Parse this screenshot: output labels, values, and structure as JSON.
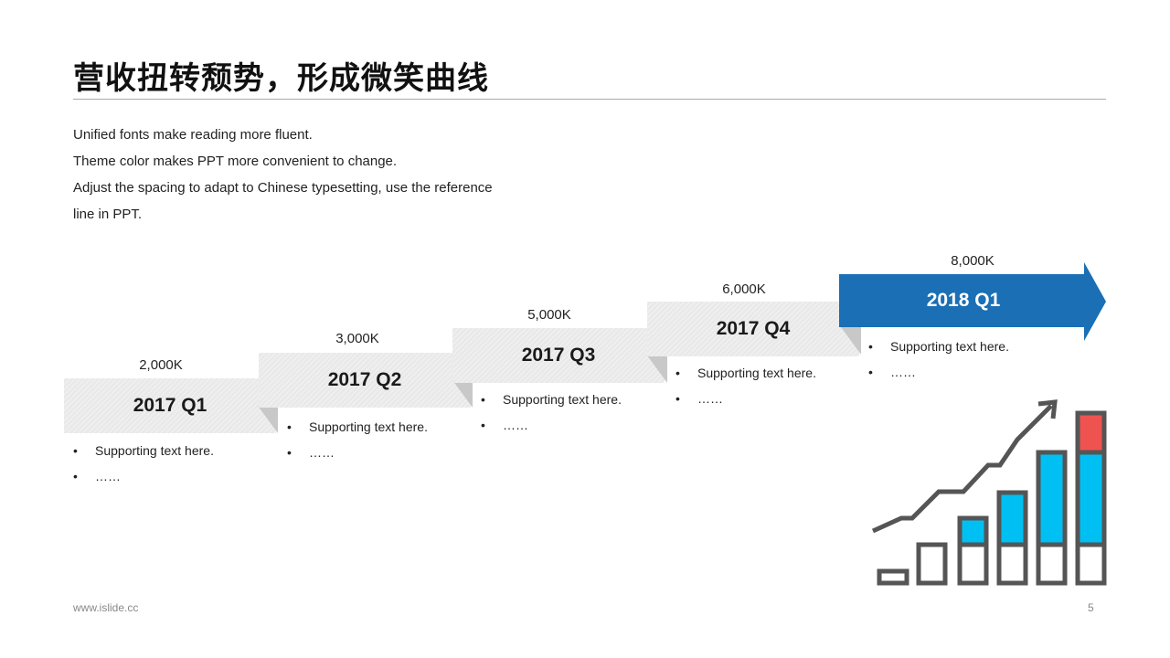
{
  "page": {
    "title": "营收扭转颓势，形成微笑曲线",
    "intro": [
      "Unified fonts make reading more fluent.",
      "Theme color makes PPT more convenient to change.",
      "Adjust the spacing to adapt to Chinese typesetting, use the reference",
      "line in PPT."
    ],
    "footer_url": "www.islide.cc",
    "page_number": "5"
  },
  "steps": [
    {
      "label": "2017 Q1",
      "value": "2,000K",
      "bullets": [
        "Supporting  text here.",
        "……"
      ]
    },
    {
      "label": "2017 Q2",
      "value": "3,000K",
      "bullets": [
        "Supporting  text here.",
        "……"
      ]
    },
    {
      "label": "2017 Q3",
      "value": "5,000K",
      "bullets": [
        "Supporting  text here.",
        "……"
      ]
    },
    {
      "label": "2017 Q4",
      "value": "6,000K",
      "bullets": [
        "Supporting  text here.",
        "……"
      ]
    },
    {
      "label": "2018 Q1",
      "value": "8,000K",
      "bullets": [
        "Supporting  text here.",
        "……"
      ]
    }
  ],
  "colors": {
    "accent_blue": "#1a6fb5",
    "band_gray": "#eeeeee",
    "fold_gray": "#c8c8c8",
    "icon_outline": "#555555",
    "icon_cyan": "#00c0f3",
    "icon_red": "#ef5350"
  },
  "icon": {
    "name": "growth-bar-chart-icon"
  }
}
